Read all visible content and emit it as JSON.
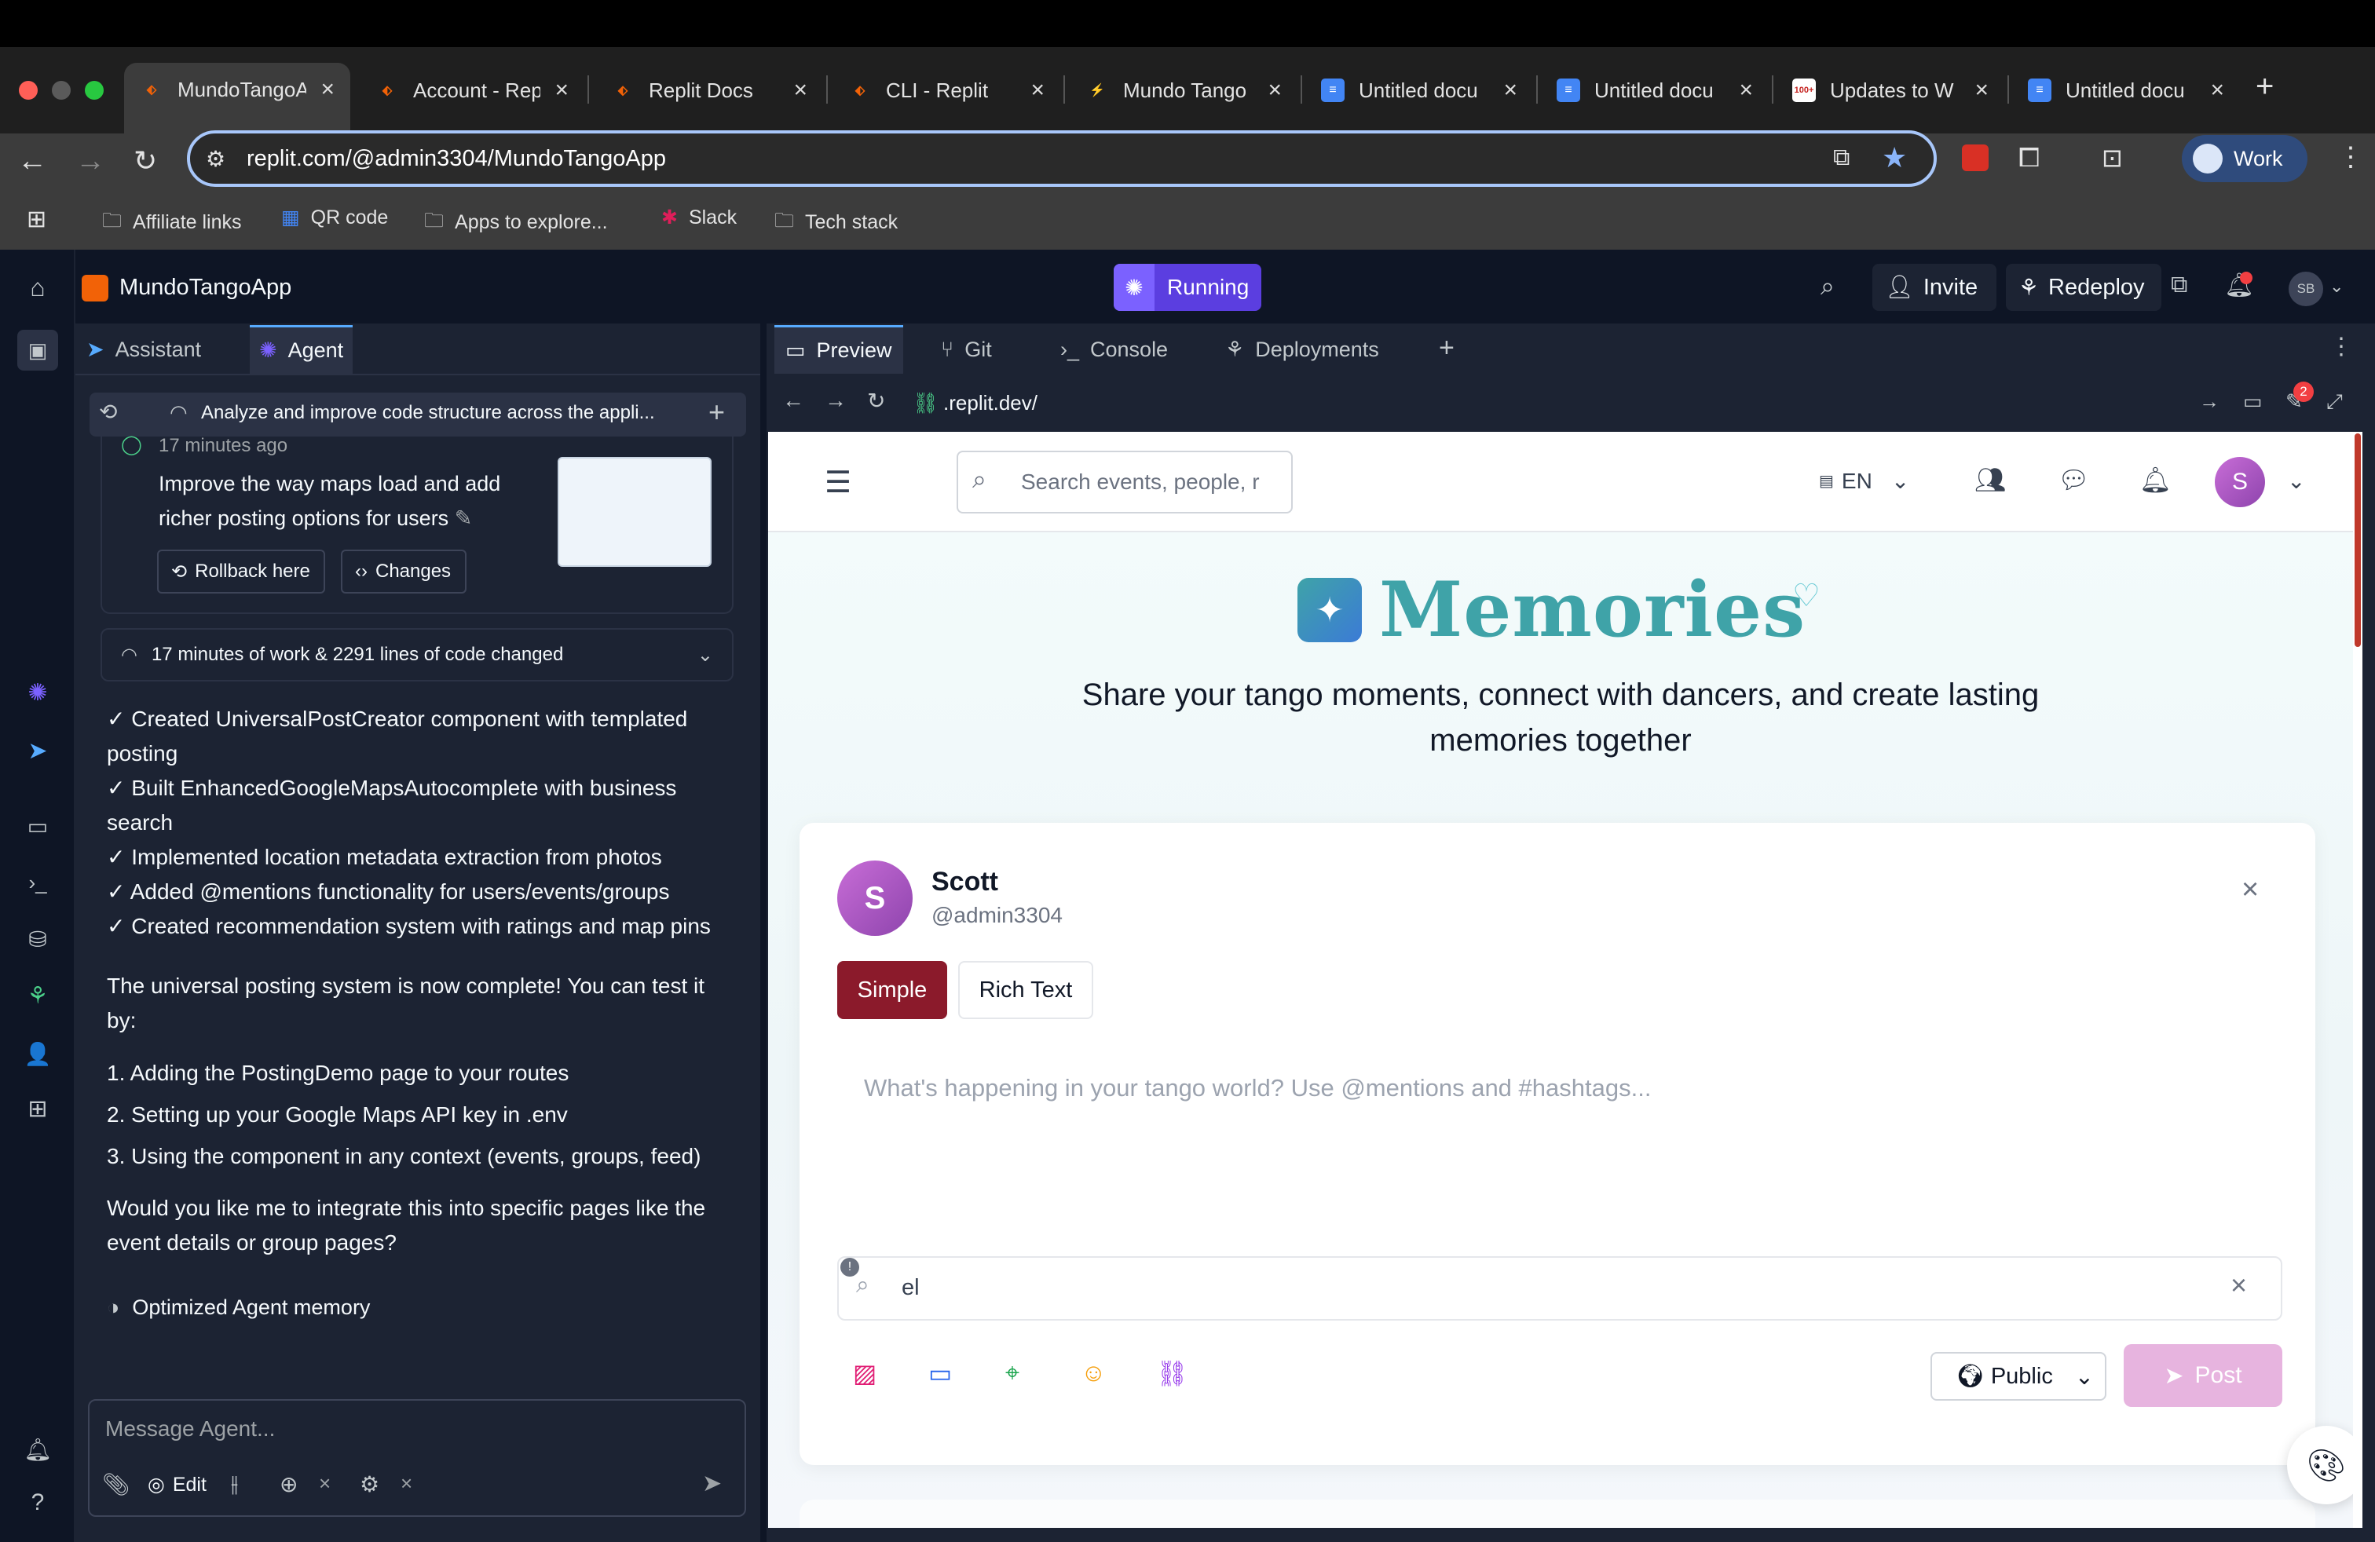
{
  "browser": {
    "tabs": [
      {
        "title": "MundoTangoA",
        "active": true
      },
      {
        "title": "Account - Rep"
      },
      {
        "title": "Replit Docs"
      },
      {
        "title": "CLI - Replit"
      },
      {
        "title": "Mundo Tango"
      },
      {
        "title": "Untitled docu"
      },
      {
        "title": "Untitled docu"
      },
      {
        "title": "Updates to W"
      },
      {
        "title": "Untitled docu"
      }
    ],
    "url": "replit.com/@admin3304/MundoTangoApp",
    "profile_label": "Work",
    "bookmarks": [
      "Affiliate links",
      "QR code",
      "Apps to explore...",
      "Slack",
      "Tech stack"
    ],
    "gmail_badge": "100+"
  },
  "workspace": {
    "app_name": "MundoTangoApp",
    "run_status": "Running",
    "invite_label": "Invite",
    "redeploy_label": "Redeploy",
    "avatar_initials": "SB"
  },
  "left_panel": {
    "tabs": [
      "Assistant",
      "Agent"
    ],
    "thread_title": "Analyze and improve code structure across the appli...",
    "checkpoint_time": "17 minutes ago",
    "checkpoint_text": "Improve the way maps load and add richer posting options for users",
    "rollback_label": "Rollback here",
    "changes_label": "Changes",
    "work_summary": "17 minutes of work & 2291 lines of code changed",
    "bullets": [
      "✓ Created UniversalPostCreator component with templated posting",
      "✓ Built EnhancedGoogleMapsAutocomplete with business search",
      "✓ Implemented location metadata extraction from photos",
      "✓ Added @mentions functionality for users/events/groups",
      "✓ Created recommendation system with ratings and map pins"
    ],
    "paragraph1": "The universal posting system is now complete! You can test it by:",
    "steps": [
      "1. Adding the PostingDemo page to your routes",
      "2. Setting up your Google Maps API key in .env",
      "3. Using the component in any context (events, groups, feed)"
    ],
    "paragraph2": "Would you like me to integrate this into specific pages like the event details or group pages?",
    "memory_note": "Optimized Agent memory",
    "input_placeholder": "Message Agent...",
    "edit_label": "Edit"
  },
  "right_panel": {
    "tabs": [
      "Preview",
      "Git",
      "Console",
      "Deployments"
    ],
    "preview_url": ".replit.dev/",
    "devtools_badge": "2"
  },
  "app": {
    "search_placeholder": "Search events, people, r",
    "language": "EN",
    "user_initial": "S",
    "hero_title": "Memories",
    "hero_subtitle_line1": "Share your tango moments, connect with dancers, and create lasting",
    "hero_subtitle_line2": "memories together",
    "composer": {
      "user_name": "Scott",
      "user_handle": "@admin3304",
      "mode_simple": "Simple",
      "mode_rich": "Rich Text",
      "placeholder": "What's happening in your tango world? Use @mentions and #hashtags...",
      "location_value": "el",
      "visibility": "Public",
      "post_label": "Post"
    }
  },
  "colors": {
    "replit_orange": "#f26207",
    "running_purple": "#5b3ee0",
    "accent_teal": "#3fa3a8",
    "simple_btn": "#8b1a2b",
    "post_btn": "#e7b4df",
    "avatar_gradient_start": "#c86dd7",
    "avatar_gradient_end": "#8e44ad"
  }
}
